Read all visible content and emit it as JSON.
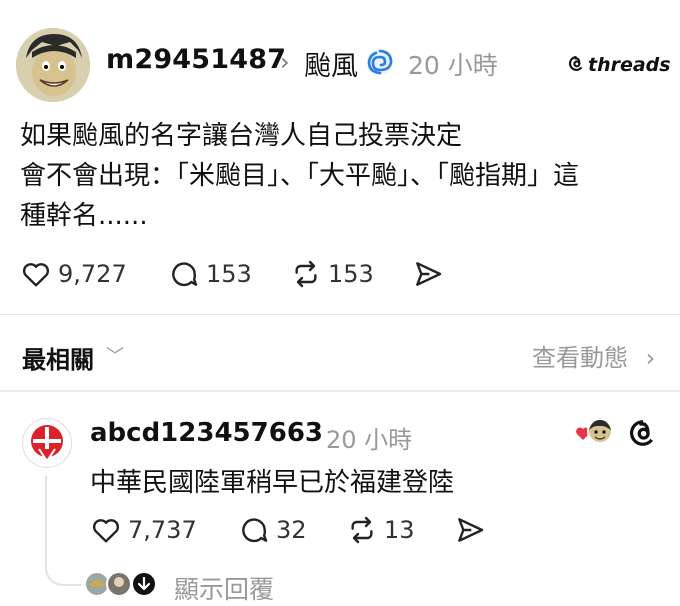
{
  "post": {
    "username": "m29451487",
    "topic": "颱風",
    "time": "20 小時",
    "brand": "threads",
    "text": "如果颱風的名字讓台灣人自己投票決定\n會不會出現：「米颱目」、「大平颱」、「颱指期」這\n種幹名......",
    "likes": "9,727",
    "replies": "153",
    "reposts": "153"
  },
  "filter": {
    "label": "最相關",
    "view_activity": "查看動態"
  },
  "comment": {
    "username": "abcd123457663",
    "time": "20 小時",
    "text": "中華民國陸軍稍早已於福建登陸",
    "likes": "7,737",
    "replies": "32",
    "reposts": "13",
    "show_replies": "顯示回覆"
  },
  "colors": {
    "text": "#111111",
    "muted": "#999999",
    "cyclone": "#2a7de1",
    "heart": "#e8334a"
  }
}
